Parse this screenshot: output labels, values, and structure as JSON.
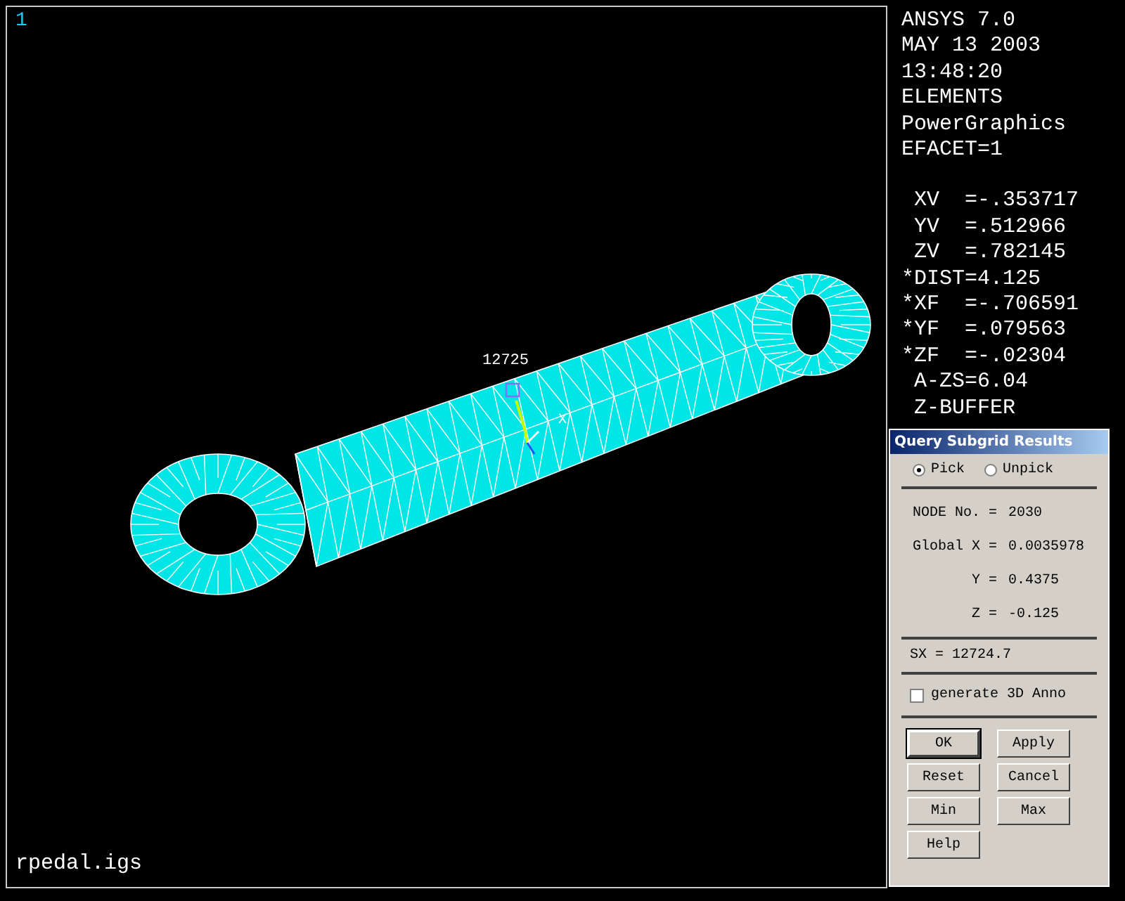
{
  "viewport": {
    "window_number": "1",
    "model_file": "rpedal.igs",
    "node_label": "12725",
    "axis_label": "X"
  },
  "info_header": [
    "ANSYS 7.0",
    "MAY 13 2003",
    "13:48:20",
    "ELEMENTS",
    "PowerGraphics",
    "EFACET=1"
  ],
  "view_params": [
    " XV  =-.353717",
    " YV  =.512966",
    " ZV  =.782145",
    "*DIST=4.125",
    "*XF  =-.706591",
    "*YF  =.079563",
    "*ZF  =-.02304",
    " A-ZS=6.04",
    " Z-BUFFER"
  ],
  "dialog": {
    "title": "Query Subgrid Results",
    "radios": [
      {
        "label": "Pick",
        "selected": true
      },
      {
        "label": "Unpick",
        "selected": false
      }
    ],
    "results": [
      {
        "label": "NODE No. =",
        "value": "2030"
      },
      {
        "label": "Global X =",
        "value": "0.0035978"
      },
      {
        "label": "Y =",
        "value": "0.4375"
      },
      {
        "label": "Z =",
        "value": "-0.125"
      }
    ],
    "result_value": "SX = 12724.7",
    "checkbox": {
      "label": "generate 3D Anno",
      "checked": false
    },
    "buttons": [
      {
        "label": "OK",
        "default": true
      },
      {
        "label": "Apply",
        "default": false
      },
      {
        "label": "Reset",
        "default": false
      },
      {
        "label": "Cancel",
        "default": false
      },
      {
        "label": "Min",
        "default": false
      },
      {
        "label": "Max",
        "default": false
      },
      {
        "label": "Help",
        "default": false
      }
    ]
  }
}
